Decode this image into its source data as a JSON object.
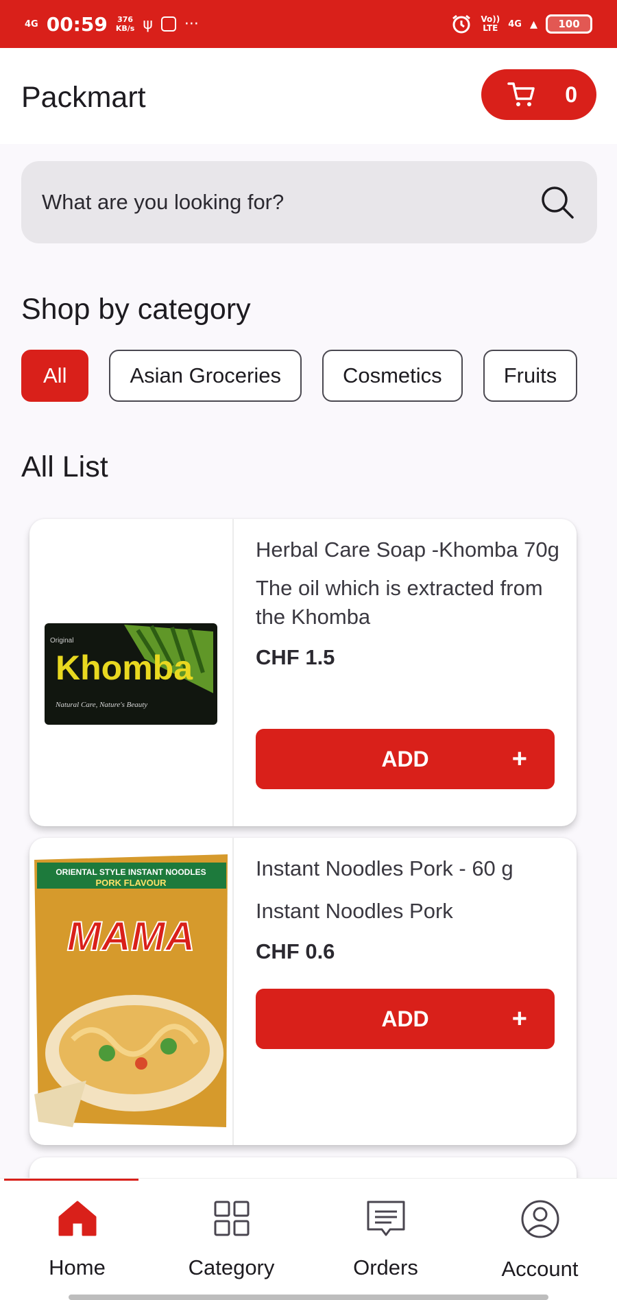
{
  "status_bar": {
    "network": "4G",
    "time": "00:59",
    "speed_value": "376",
    "speed_unit": "KB/s",
    "volte": "Vo))",
    "lte": "LTE",
    "network_right": "4G",
    "battery": "100"
  },
  "header": {
    "title": "Packmart",
    "cart_count": "0"
  },
  "search": {
    "placeholder": "What are you looking for?"
  },
  "categories": {
    "title": "Shop by category",
    "chips": [
      "All",
      "Asian Groceries",
      "Cosmetics",
      "Fruits"
    ],
    "active_index": 0
  },
  "list": {
    "title": "All List",
    "products": [
      {
        "name": "Herbal Care Soap -Khomba 70g",
        "description": "The oil which is extracted from the Khomba",
        "price": "CHF 1.5",
        "add_label": "ADD",
        "add_icon": "+",
        "image_text": "Khomba",
        "image_subtext": "Original",
        "image_tagline": "Natural Care, Nature's Beauty"
      },
      {
        "name": "Instant Noodles Pork - 60 g",
        "description": "Instant Noodles Pork",
        "price": "CHF 0.6",
        "add_label": "ADD",
        "add_icon": "+",
        "image_banner": "ORIENTAL STYLE INSTANT NOODLES",
        "image_flavour": "PORK FLAVOUR",
        "image_text": "MAMA"
      }
    ]
  },
  "bottom_nav": {
    "items": [
      {
        "label": "Home",
        "icon": "home-icon",
        "active": true
      },
      {
        "label": "Category",
        "icon": "grid-icon",
        "active": false
      },
      {
        "label": "Orders",
        "icon": "receipt-icon",
        "active": false
      },
      {
        "label": "Account",
        "icon": "account-icon",
        "active": false
      }
    ]
  },
  "colors": {
    "primary": "#d9201a",
    "background": "#faf8fc",
    "search_bg": "#e8e6ea"
  }
}
